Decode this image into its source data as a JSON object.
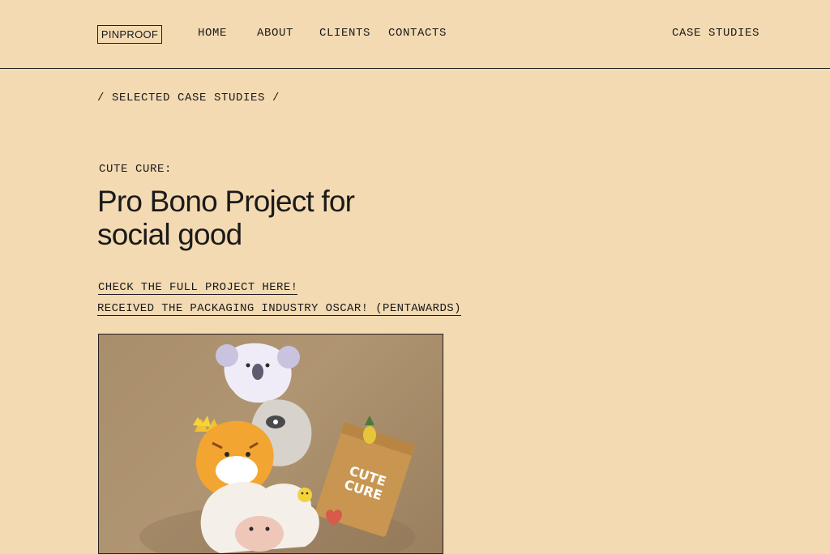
{
  "header": {
    "logo_text": "PINPROOF",
    "nav": {
      "home": "HOME",
      "about": "ABOUT",
      "clients": "CLIENTS",
      "contacts": "CONTACTS"
    },
    "case_studies": "CASE STUDIES"
  },
  "breadcrumb": "/ SELECTED CASE STUDIES /",
  "project": {
    "eyebrow": "CUTE CURE:",
    "title": "Pro Bono Project for social good",
    "links": {
      "full_project": "CHECK THE FULL PROJECT HERE!",
      "award": "RECEIVED THE PACKAGING INDUSTRY OSCAR! (PENTAWARDS)"
    }
  },
  "colors": {
    "background": "#f3dab2",
    "text": "#1a1a1a",
    "hero_backdrop": "#a98e6c"
  },
  "hero_image": {
    "icons": [
      "koala-icon",
      "tiger-icon",
      "lamb-icon",
      "pineapple-icon",
      "packaging-bag-icon"
    ]
  }
}
